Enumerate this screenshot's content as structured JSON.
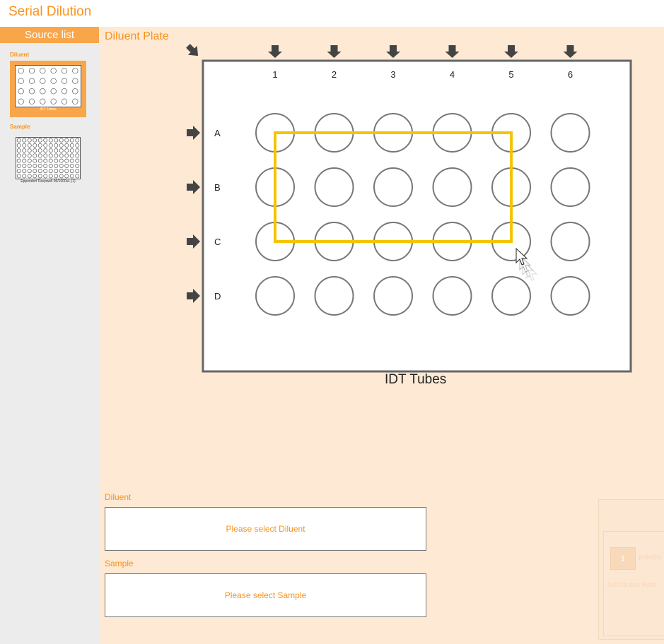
{
  "app": {
    "title": "Serial Dilution"
  },
  "sidebar": {
    "header": "Source list",
    "groups": [
      {
        "label": "Diluent",
        "items": [
          {
            "caption": "IDT Tubes",
            "selected": true
          }
        ]
      },
      {
        "label": "Sample",
        "items": [
          {
            "caption": "Eppendorf Deepwell 96/1000uL (1)",
            "selected": false
          }
        ]
      }
    ]
  },
  "plate_view": {
    "title": "Diluent Plate",
    "plate_name": "IDT Tubes",
    "columns": [
      "1",
      "2",
      "3",
      "4",
      "5",
      "6"
    ],
    "rows": [
      "A",
      "B",
      "C",
      "D"
    ],
    "selection": {
      "rows": [
        "A",
        "C"
      ],
      "columns": [
        "1",
        "5"
      ],
      "color": "#f5c400"
    }
  },
  "form": {
    "diluent": {
      "label": "Diluent",
      "placeholder": "Please select Diluent"
    },
    "sample": {
      "label": "Sample",
      "placeholder": "Please select Sample"
    }
  },
  "dilution_panel": {
    "points_value": "1",
    "points_unit": "point(s)",
    "set_ratio_label": "Set Dilution Ratio"
  },
  "colors": {
    "accent": "#f7931e",
    "accent_light": "#f9a64b",
    "main_bg": "#fde9d4",
    "sidebar_bg": "#ececec",
    "well_stroke": "#777777",
    "arrow": "#444444"
  },
  "icons": {
    "column_selector": "arrow-down-icon",
    "row_selector": "arrow-right-icon",
    "select_all": "arrow-diagonal-icon",
    "cursor": "mouse-pointer-icon"
  }
}
